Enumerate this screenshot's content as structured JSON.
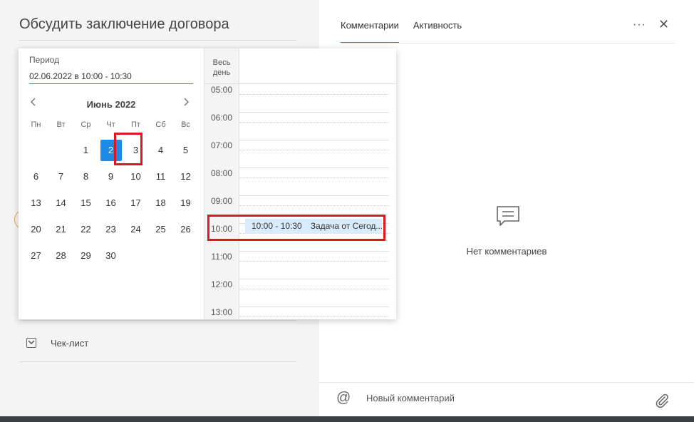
{
  "task": {
    "title": "Обсудить заключение договора"
  },
  "checklist": {
    "label": "Чек-лист"
  },
  "picker": {
    "period_label": "Период",
    "period_value": "02.06.2022 в 10:00 - 10:30",
    "month_label": "Июнь 2022",
    "weekdays": [
      "Пн",
      "Вт",
      "Ср",
      "Чт",
      "Пт",
      "Сб",
      "Вс"
    ],
    "days": [
      [
        "",
        "",
        "1",
        "2",
        "3",
        "4",
        "5"
      ],
      [
        "6",
        "7",
        "8",
        "9",
        "10",
        "11",
        "12"
      ],
      [
        "13",
        "14",
        "15",
        "16",
        "17",
        "18",
        "19"
      ],
      [
        "20",
        "21",
        "22",
        "23",
        "24",
        "25",
        "26"
      ],
      [
        "27",
        "28",
        "29",
        "30",
        "",
        "",
        ""
      ]
    ],
    "selected_day": "2",
    "all_day_label_line1": "Весь",
    "all_day_label_line2": "день",
    "hours": [
      "05:00",
      "06:00",
      "07:00",
      "08:00",
      "09:00",
      "10:00",
      "11:00",
      "12:00",
      "13:00"
    ],
    "event": {
      "time": "10:00 - 10:30",
      "title": "Задача от Сегод..."
    }
  },
  "comments": {
    "tabs": [
      {
        "label": "Комментарии",
        "active": true
      },
      {
        "label": "Активность",
        "active": false
      }
    ],
    "more_label": "···",
    "close_label": "✕",
    "empty_text": "Нет комментариев",
    "at_symbol": "@",
    "input_placeholder": "Новый комментарий"
  },
  "colors": {
    "accent": "#1e88e5",
    "highlight": "#e0161f",
    "event_bg": "#d9ecfb"
  }
}
